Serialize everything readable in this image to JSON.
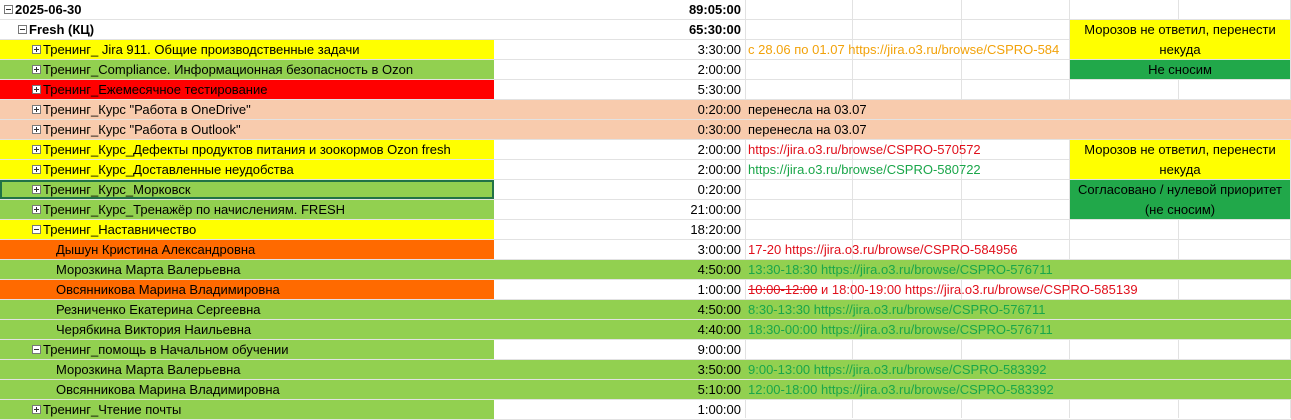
{
  "colors": {
    "yellow": "#ffff00",
    "green": "#92d050",
    "red": "#ff0000",
    "peach": "#f8cbad",
    "orange": "#ff6a00",
    "dark_green": "#21a84a",
    "link_red": "#e0101c",
    "link_green": "#1aa64a",
    "link_orange": "#f2a20a"
  },
  "rows": [
    {
      "label": "2025-06-30",
      "duration": "89:05:00",
      "note": "",
      "bold": true,
      "expander": "minus"
    },
    {
      "label": "Fresh (КЦ)",
      "duration": "65:30:00",
      "note": "",
      "bold": true,
      "expander": "minus"
    },
    {
      "label": "Тренинг_ Jira 911. Общие производственные задачи",
      "duration": "3:30:00",
      "note": "с 28.06 по 01.07 https://jira.o3.ru/browse/CSPRO-584",
      "expander": "plus"
    },
    {
      "label": "Тренинг_Compliance. Информационная безопасность в Ozon",
      "duration": "2:00:00",
      "note": "",
      "expander": "plus"
    },
    {
      "label": "Тренинг_Ежемесячное тестирование",
      "duration": "5:30:00",
      "note": "",
      "expander": "plus"
    },
    {
      "label": "Тренинг_Курс \"Работа в OneDrive\"",
      "duration": "0:20:00",
      "note": "перенесла на 03.07",
      "expander": "plus"
    },
    {
      "label": "Тренинг_Курс \"Работа в Outlook\"",
      "duration": "0:30:00",
      "note": "перенесла на 03.07",
      "expander": "plus"
    },
    {
      "label": "Тренинг_Курс_Дефекты продуктов питания и зоокормов Ozon fresh",
      "duration": "2:00:00",
      "note": "https://jira.o3.ru/browse/CSPRO-570572",
      "expander": "plus"
    },
    {
      "label": "Тренинг_Курс_Доставленные неудобства",
      "duration": "2:00:00",
      "note": "https://jira.o3.ru/browse/CSPRO-580722",
      "expander": "plus"
    },
    {
      "label": "Тренинг_Курс_Морковск",
      "duration": "0:20:00",
      "note": "",
      "expander": "plus"
    },
    {
      "label": "Тренинг_Курс_Тренажёр по начислениям. FRESH",
      "duration": "21:00:00",
      "note": "",
      "expander": "plus"
    },
    {
      "label": "Тренинг_Наставничество",
      "duration": "18:20:00",
      "note": "",
      "expander": "minus"
    },
    {
      "label": "Дышун Кристина Александровна",
      "duration": "3:00:00",
      "note": "17-20 https://jira.o3.ru/browse/CSPRO-584956"
    },
    {
      "label": "Морозкина Марта Валерьевна",
      "duration": "4:50:00",
      "note": "13:30-18:30 https://jira.o3.ru/browse/CSPRO-576711"
    },
    {
      "label": "Овсянникова Марина Владимировна",
      "duration": "1:00:00",
      "note_strike": "10:00-12:00",
      "note": " и 18:00-19:00 https://jira.o3.ru/browse/CSPRO-585139"
    },
    {
      "label": "Резниченко Екатерина Сергеевна",
      "duration": "4:50:00",
      "note": "8:30-13:30 https://jira.o3.ru/browse/CSPRO-576711"
    },
    {
      "label": "Черябкина Виктория Наильевна",
      "duration": "4:40:00",
      "note": "18:30-00:00 https://jira.o3.ru/browse/CSPRO-576711"
    },
    {
      "label": "Тренинг_помощь в Начальном обучении",
      "duration": "9:00:00",
      "note": "",
      "expander": "minus"
    },
    {
      "label": "Морозкина Марта Валерьевна",
      "duration": "3:50:00",
      "note": "9:00-13:00 https://jira.o3.ru/browse/CSPRO-583392"
    },
    {
      "label": "Овсянникова Марина Владимировна",
      "duration": "5:10:00",
      "note": "12:00-18:00 https://jira.o3.ru/browse/CSPRO-583392"
    },
    {
      "label": "Тренинг_Чтение почты",
      "duration": "1:00:00",
      "note": "",
      "expander": "plus"
    }
  ],
  "comments": [
    {
      "text": "Морозов не ответил, перенести некуда"
    },
    {
      "text": "Не сносим"
    },
    {
      "text": "Морозов не ответил, перенести некуда"
    },
    {
      "text": "Согласовано / нулевой приоритет (не сносим)"
    }
  ]
}
